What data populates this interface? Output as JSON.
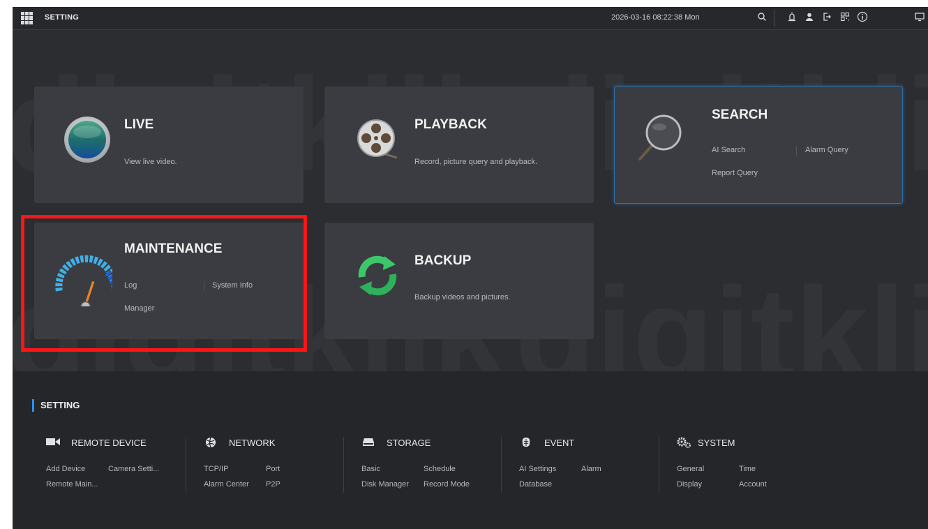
{
  "topbar": {
    "title": "SETTING",
    "datetime": "2026-03-16 08:22:38 Mon",
    "icons": [
      "search-icon",
      "alarm-icon",
      "user-icon",
      "logout-icon",
      "qrcode-icon",
      "info-icon",
      "monitor-icon"
    ]
  },
  "cards": {
    "live": {
      "title": "LIVE",
      "desc": "View live video."
    },
    "playback": {
      "title": "PLAYBACK",
      "desc": "Record, picture query and playback."
    },
    "search": {
      "title": "SEARCH",
      "links": [
        "AI Search",
        "Alarm Query",
        "Report Query"
      ]
    },
    "maintenance": {
      "title": "MAINTENANCE",
      "links": [
        "Log",
        "System Info",
        "Manager"
      ]
    },
    "backup": {
      "title": "BACKUP",
      "desc": "Backup videos and pictures."
    }
  },
  "settings": {
    "title": "SETTING",
    "categories": [
      {
        "label": "REMOTE DEVICE",
        "links": [
          "Add Device",
          "Camera Setti...",
          "Remote Main..."
        ]
      },
      {
        "label": "NETWORK",
        "links": [
          "TCP/IP",
          "Port",
          "Alarm Center",
          "P2P"
        ]
      },
      {
        "label": "STORAGE",
        "links": [
          "Basic",
          "Schedule",
          "Disk Manager",
          "Record Mode"
        ]
      },
      {
        "label": "EVENT",
        "links": [
          "AI Settings",
          "Alarm",
          "Database"
        ]
      },
      {
        "label": "SYSTEM",
        "links": [
          "General",
          "Time",
          "Display",
          "Account"
        ]
      }
    ]
  },
  "watermark": "digitklik",
  "colors": {
    "accent": "#2f8fff",
    "highlight": "#ff1515"
  }
}
